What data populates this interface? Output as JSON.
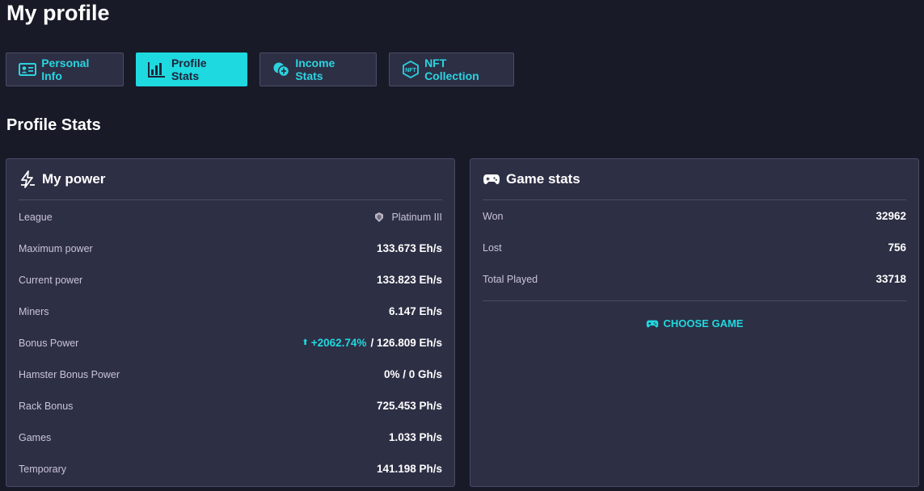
{
  "page": {
    "title": "My profile"
  },
  "tabs": [
    {
      "label": "Personal Info",
      "icon": "id-card-icon",
      "active": false
    },
    {
      "label": "Profile Stats",
      "icon": "bar-chart-icon",
      "active": true
    },
    {
      "label": "Income Stats",
      "icon": "coins-icon",
      "active": false
    },
    {
      "label": "NFT Collection",
      "icon": "nft-icon",
      "active": false
    }
  ],
  "section": {
    "title": "Profile Stats"
  },
  "power": {
    "title": "My power",
    "icon": "lightning-icon",
    "rows": [
      {
        "label": "League",
        "value": "Platinum III",
        "icon": "league-badge-icon"
      },
      {
        "label": "Maximum power",
        "value": "133.673 Eh/s"
      },
      {
        "label": "Current power",
        "value": "133.823 Eh/s"
      },
      {
        "label": "Miners",
        "value": "6.147 Eh/s"
      },
      {
        "label": "Bonus Power",
        "bonus": "+2062.74%",
        "value": "/ 126.809 Eh/s"
      },
      {
        "label": "Hamster Bonus Power",
        "value": "0% / 0 Gh/s"
      },
      {
        "label": "Rack Bonus",
        "value": "725.453 Ph/s"
      },
      {
        "label": "Games",
        "value": "1.033 Ph/s"
      },
      {
        "label": "Temporary",
        "value": "141.198 Ph/s"
      }
    ]
  },
  "game": {
    "title": "Game stats",
    "icon": "gamepad-icon",
    "rows": [
      {
        "label": "Won",
        "value": "32962"
      },
      {
        "label": "Lost",
        "value": "756"
      },
      {
        "label": "Total Played",
        "value": "33718"
      }
    ],
    "choose_label": "CHOOSE GAME"
  },
  "colors": {
    "accent": "#1ed9df",
    "background": "#181a28",
    "card": "#2d2f45"
  }
}
